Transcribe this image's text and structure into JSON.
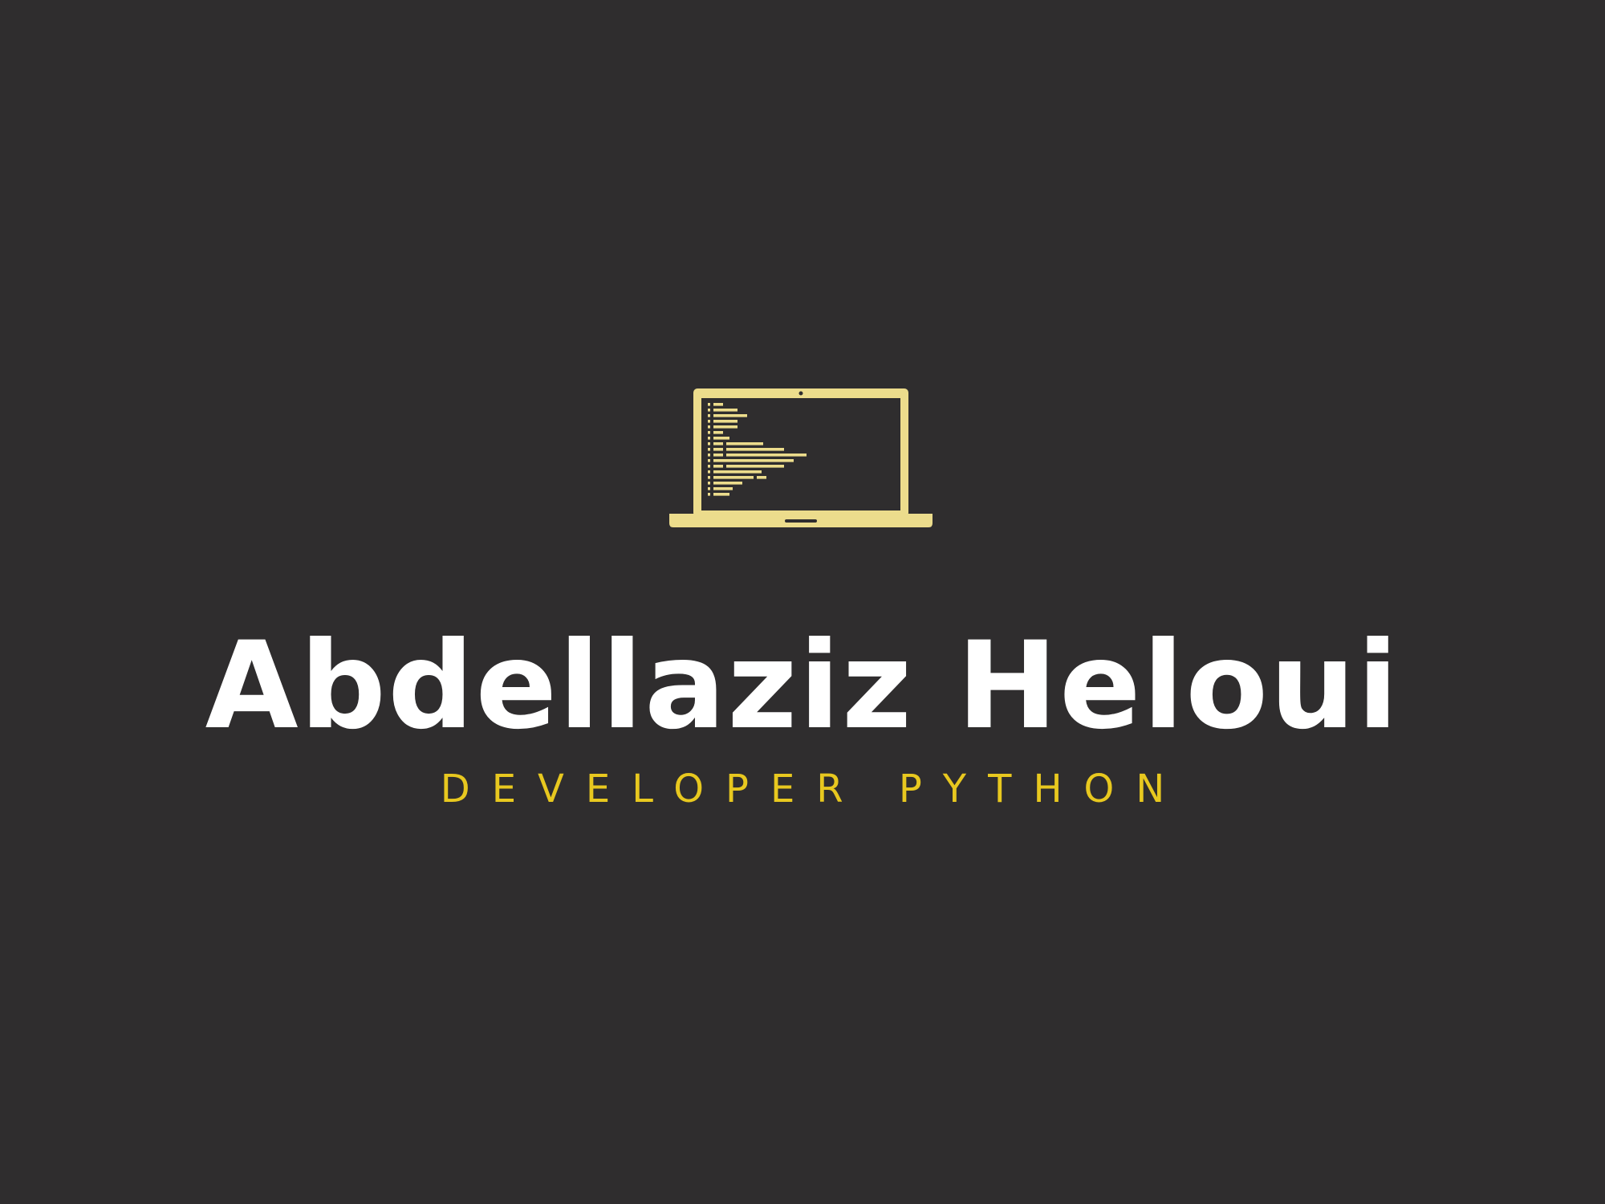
{
  "colors": {
    "background": "#2f2d2e",
    "accent": "#ecdc8c",
    "subtitle": "#e8c81f",
    "title": "#ffffff"
  },
  "logo": {
    "icon": "laptop-code-icon"
  },
  "brand": {
    "name": "Abdellaziz Heloui",
    "tagline": "DEVELOPER PYTHON"
  }
}
